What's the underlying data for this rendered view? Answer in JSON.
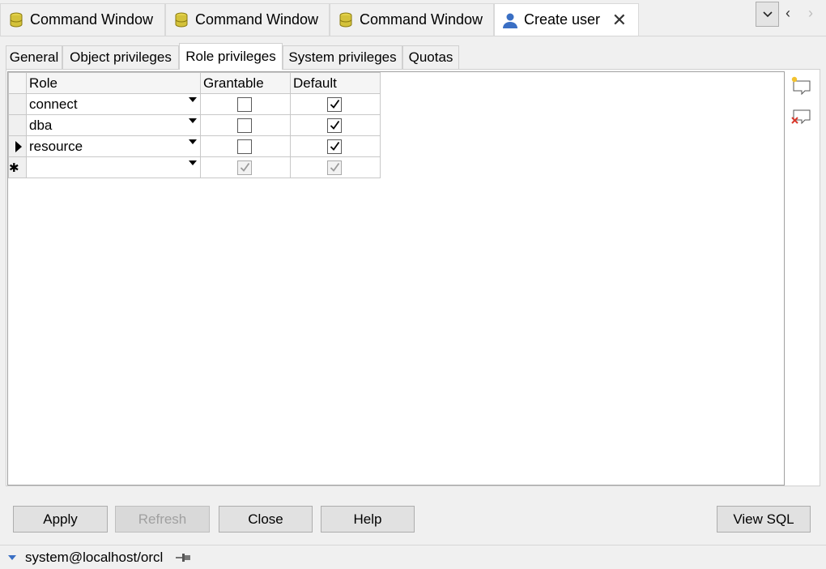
{
  "doc_tabs": [
    {
      "label": "Command Window",
      "icon": "database-icon"
    },
    {
      "label": "Command Window",
      "icon": "database-icon"
    },
    {
      "label": "Command Window",
      "icon": "database-icon"
    },
    {
      "label": "Create user",
      "icon": "user-icon",
      "active": true,
      "close": "✕"
    }
  ],
  "nav": {
    "dropdown": "chevron-down-icon",
    "prev": "‹",
    "next": "›"
  },
  "prop_tabs": [
    "General",
    "Object privileges",
    "Role privileges",
    "System privileges",
    "Quotas"
  ],
  "active_prop_tab": "Role privileges",
  "grid": {
    "headers": {
      "role": "Role",
      "grantable": "Grantable",
      "default": "Default"
    },
    "rows": [
      {
        "role": "connect",
        "grantable": false,
        "default": true
      },
      {
        "role": "dba",
        "grantable": false,
        "default": true
      },
      {
        "role": "resource",
        "grantable": false,
        "default": true,
        "current": true
      },
      {
        "role": "",
        "grantable": true,
        "default": true,
        "new_row": true
      }
    ],
    "new_row_marker": "✱"
  },
  "buttons": {
    "apply": "Apply",
    "refresh": "Refresh",
    "close": "Close",
    "help": "Help",
    "view_sql": "View SQL"
  },
  "status": {
    "connection": "system@localhost/orcl"
  },
  "colors": {
    "accent_blue": "#3a6fc4",
    "delete_red": "#d9382b",
    "db_yellow": "#d4c23a"
  }
}
